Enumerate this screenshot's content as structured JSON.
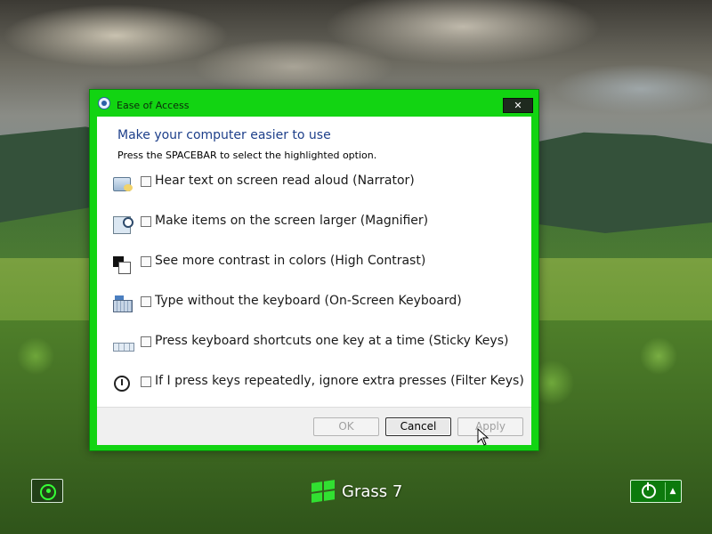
{
  "dialog": {
    "title": "Ease of Access",
    "close_label": "✕",
    "heading": "Make your computer easier to use",
    "subheading": "Press the SPACEBAR to select the highlighted option.",
    "options": [
      {
        "label": "Hear text on screen read aloud (Narrator)",
        "icon": "narrator-icon",
        "checked": false
      },
      {
        "label": "Make items on the screen larger (Magnifier)",
        "icon": "magnifier-icon",
        "checked": false
      },
      {
        "label": "See more contrast in colors (High Contrast)",
        "icon": "high-contrast-icon",
        "checked": false
      },
      {
        "label": "Type without the keyboard (On-Screen Keyboard)",
        "icon": "on-screen-keyboard-icon",
        "checked": false
      },
      {
        "label": "Press keyboard shortcuts one key at a time (Sticky Keys)",
        "icon": "sticky-keys-icon",
        "checked": false
      },
      {
        "label": "If I press keys repeatedly, ignore extra presses (Filter Keys)",
        "icon": "filter-keys-icon",
        "checked": false
      }
    ],
    "buttons": {
      "ok": "OK",
      "cancel": "Cancel",
      "apply": "Apply"
    }
  },
  "logon": {
    "brand_name": "Grass 7",
    "ease_of_access_icon": "ease-of-access-icon",
    "power_icon": "power-icon",
    "power_menu_glyph": "▲"
  },
  "colors": {
    "accent": "#12d412",
    "heading": "#1d3f8a"
  }
}
